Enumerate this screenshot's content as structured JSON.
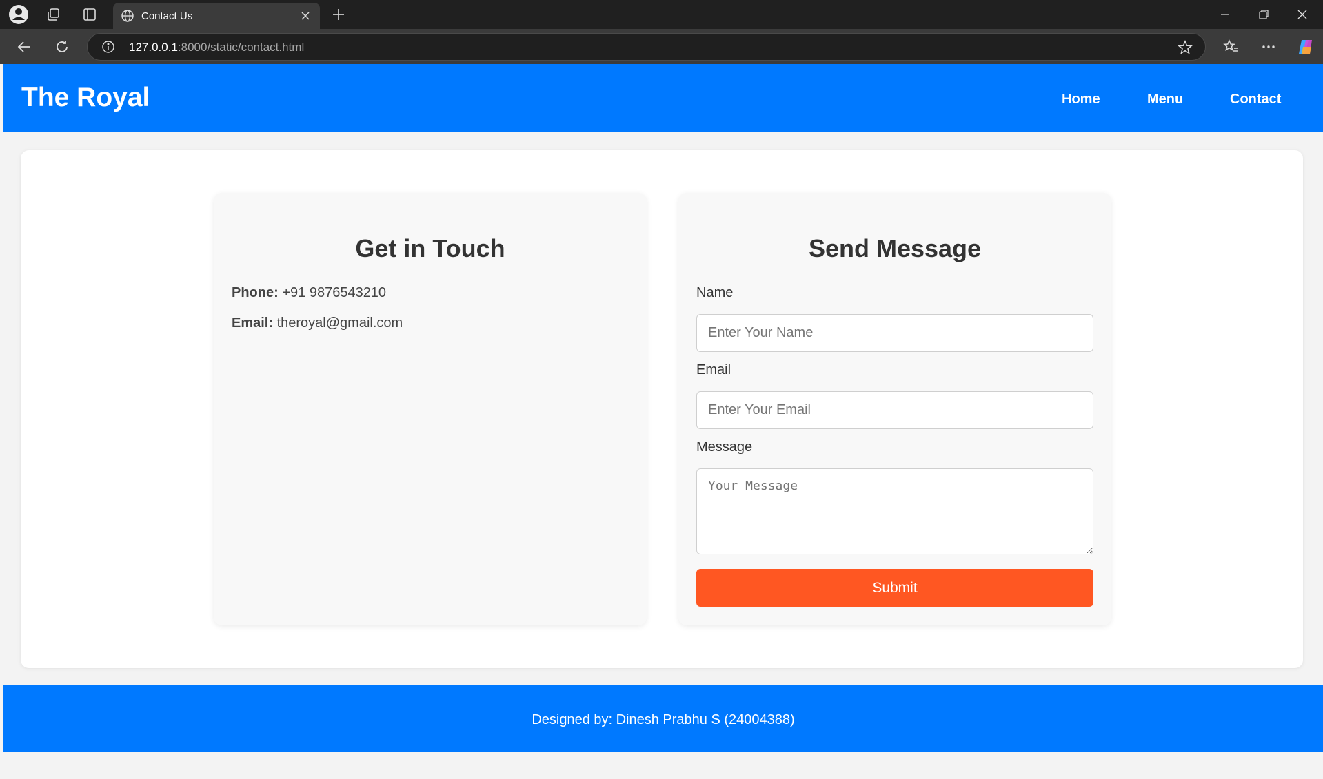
{
  "browser": {
    "tab_title": "Contact Us",
    "url_host": "127.0.0.1",
    "url_rest": ":8000/static/contact.html"
  },
  "nav": {
    "brand": "The Royal",
    "links": [
      "Home",
      "Menu",
      "Contact"
    ]
  },
  "contact_info": {
    "title": "Get in Touch",
    "phone_label": "Phone:",
    "phone_value": "+91 9876543210",
    "email_label": "Email:",
    "email_value": "theroyal@gmail.com"
  },
  "form": {
    "title": "Send Message",
    "name_label": "Name",
    "name_placeholder": "Enter Your Name",
    "email_label": "Email",
    "email_placeholder": "Enter Your Email",
    "message_label": "Message",
    "message_placeholder": "Your Message",
    "submit_label": "Submit"
  },
  "footer": {
    "text": "Designed by: Dinesh Prabhu S (24004388)"
  },
  "colors": {
    "primary": "#0079ff",
    "accent": "#ff5722",
    "card_bg": "#f8f8f8"
  }
}
